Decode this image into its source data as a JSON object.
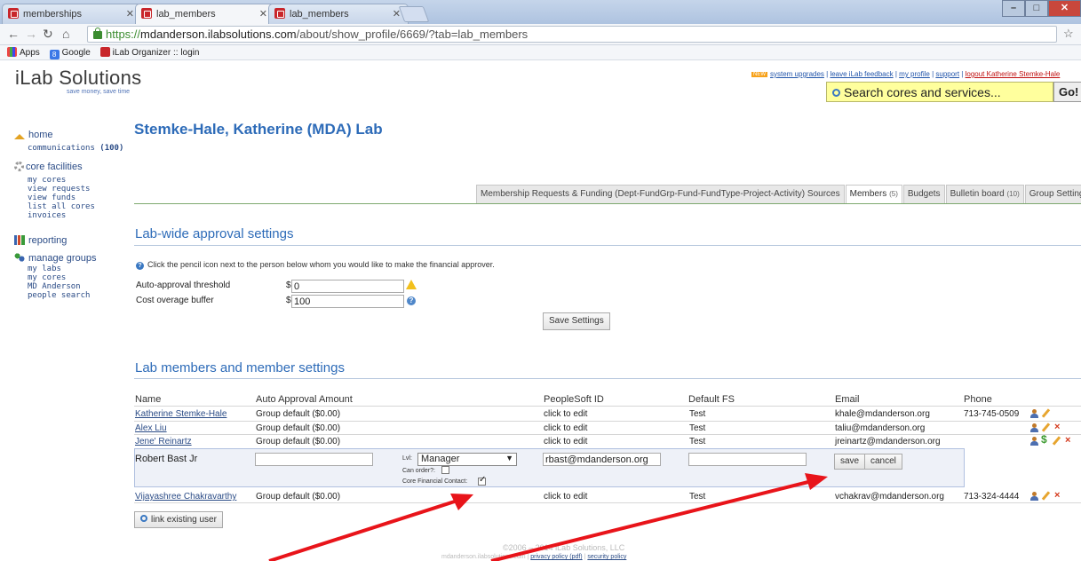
{
  "browser": {
    "tabs": [
      {
        "label": "memberships",
        "active": false
      },
      {
        "label": "lab_members",
        "active": true
      },
      {
        "label": "lab_members",
        "active": false
      }
    ],
    "url_scheme": "https://",
    "url_host": "mdanderson.ilabsolutions.com",
    "url_path": "/about/show_profile/6669/?tab=lab_members",
    "bookmarks": [
      {
        "label": "Apps",
        "icon": "apps-icon"
      },
      {
        "label": "Google",
        "icon": "google-icon"
      },
      {
        "label": "iLab Organizer :: login",
        "icon": "ilab-icon"
      }
    ]
  },
  "header": {
    "logo": "iLab Solutions",
    "tagline": "save money, save time",
    "new_badge": "NEW",
    "links": [
      "system upgrades",
      "leave iLab feedback",
      "my profile",
      "support",
      "logout Katherine Stemke-Hale"
    ],
    "search_placeholder": "Search cores and services...",
    "go_label": "Go!"
  },
  "sidebar": {
    "home": "home",
    "communications": "communications",
    "communications_count": "(100)",
    "core_facilities": "core facilities",
    "core_items": [
      "my cores",
      "view requests",
      "view funds",
      "list all cores",
      "invoices"
    ],
    "reporting": "reporting",
    "manage_groups": "manage groups",
    "group_items": [
      "my labs",
      "my cores",
      "MD Anderson",
      "people search"
    ]
  },
  "main": {
    "title": "Stemke-Hale, Katherine (MDA) Lab",
    "tabs": [
      {
        "label": "Membership Requests & Funding (Dept-FundGrp-Fund-FundType-Project-Activity) Sources",
        "count": ""
      },
      {
        "label": "Members",
        "count": "(5)"
      },
      {
        "label": "Budgets",
        "count": ""
      },
      {
        "label": "Bulletin board",
        "count": "(10)"
      },
      {
        "label": "Group Settings",
        "count": ""
      }
    ],
    "approval": {
      "heading": "Lab-wide approval settings",
      "hint": "Click the pencil icon next to the person below whom you would like to make the financial approver.",
      "threshold_label": "Auto-approval threshold",
      "threshold_value": "0",
      "buffer_label": "Cost overage buffer",
      "buffer_value": "100",
      "currency": "$",
      "save_label": "Save Settings"
    },
    "members": {
      "heading": "Lab members and member settings",
      "columns": [
        "Name",
        "Auto Approval Amount",
        "PeopleSoft ID",
        "Default FS",
        "Email",
        "Phone"
      ],
      "rows": [
        {
          "name": "Katherine Stemke-Hale",
          "amount": "Group default ($0.00)",
          "psid": "click to edit",
          "fs": "Test",
          "email": "khale@mdanderson.org",
          "phone": "713-745-0509"
        },
        {
          "name": "Alex Liu",
          "amount": "Group default ($0.00)",
          "psid": "click to edit",
          "fs": "Test",
          "email": "taliu@mdanderson.org",
          "phone": ""
        },
        {
          "name": "Jene' Reinartz",
          "amount": "Group default ($0.00)",
          "psid": "click to edit",
          "fs": "Test",
          "email": "jreinartz@mdanderson.org",
          "phone": ""
        },
        {
          "name": "Vijayashree Chakravarthy",
          "amount": "Group default ($0.00)",
          "psid": "click to edit",
          "fs": "Test",
          "email": "vchakrav@mdanderson.org",
          "phone": "713-324-4444"
        }
      ],
      "edit_row": {
        "name": "Robert Bast Jr",
        "level_label": "Lvl:",
        "level_value": "Manager",
        "can_order_label": "Can order?:",
        "core_contact_label": "Core Financial Contact:",
        "email_value": "rbast@mdanderson.org",
        "save_label": "save",
        "cancel_label": "cancel"
      },
      "link_existing_label": "link existing user"
    },
    "footer": {
      "copyright": "©2006 – 2014 iLab Solutions, LLC",
      "domain": "mdanderson.ilabsolutions.com",
      "privacy": "privacy policy (pdf)",
      "security": "security policy"
    }
  },
  "colors": {
    "accent": "#2d6bb8",
    "annotation_arrow": "#e8141a",
    "search_bg": "#ffff9d"
  }
}
